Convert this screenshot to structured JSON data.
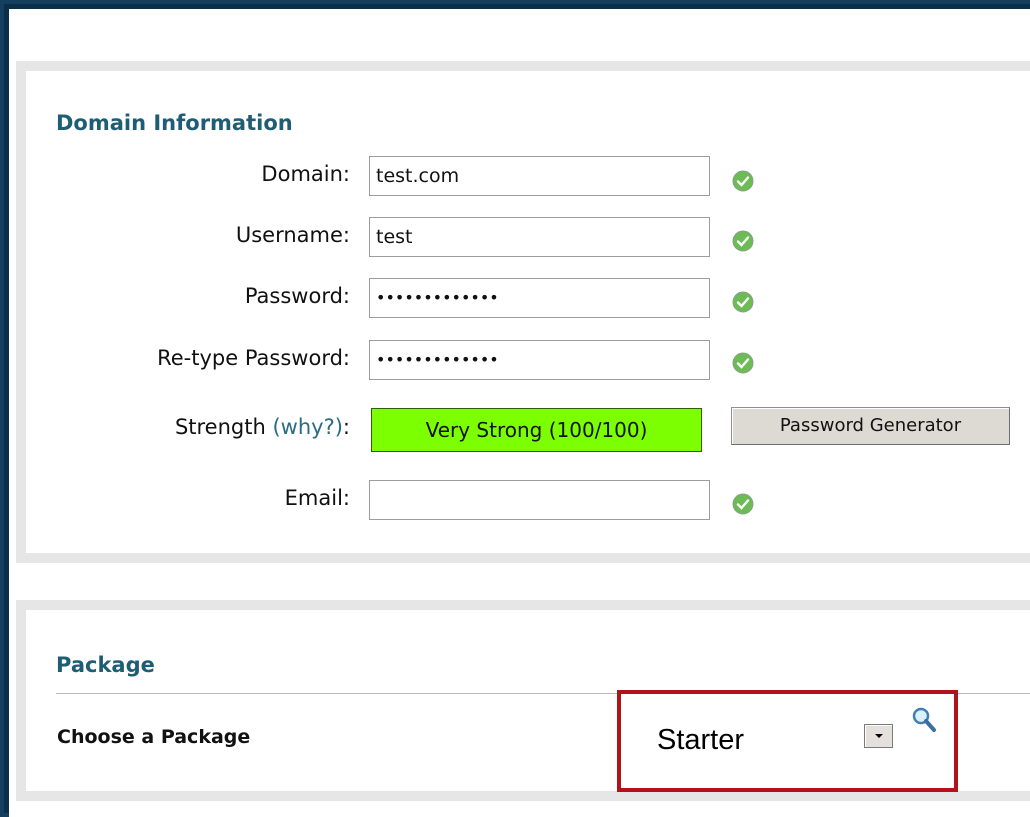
{
  "domain_section": {
    "title": "Domain Information",
    "rows": [
      {
        "label": "Domain:",
        "value": "test.com"
      },
      {
        "label": "Username:",
        "value": "test"
      },
      {
        "label": "Password:",
        "value": "•••••••••••••"
      },
      {
        "label": "Re-type Password:",
        "value": "•••••••••••••"
      },
      {
        "label": "Email:",
        "value": ""
      }
    ],
    "strength": {
      "label": "Strength",
      "why_link": "(why?)",
      "colon": ":",
      "value": "Very Strong (100/100)",
      "color": "#7cff00"
    },
    "password_generator_label": "Password Generator"
  },
  "package_section": {
    "title": "Package",
    "choose_label": "Choose a Package",
    "selected": "Starter"
  },
  "colors": {
    "section_title": "#1f5d74",
    "link": "#2a6c86",
    "ok_icon": "#5cb85c",
    "highlight_border": "#b4121b"
  }
}
